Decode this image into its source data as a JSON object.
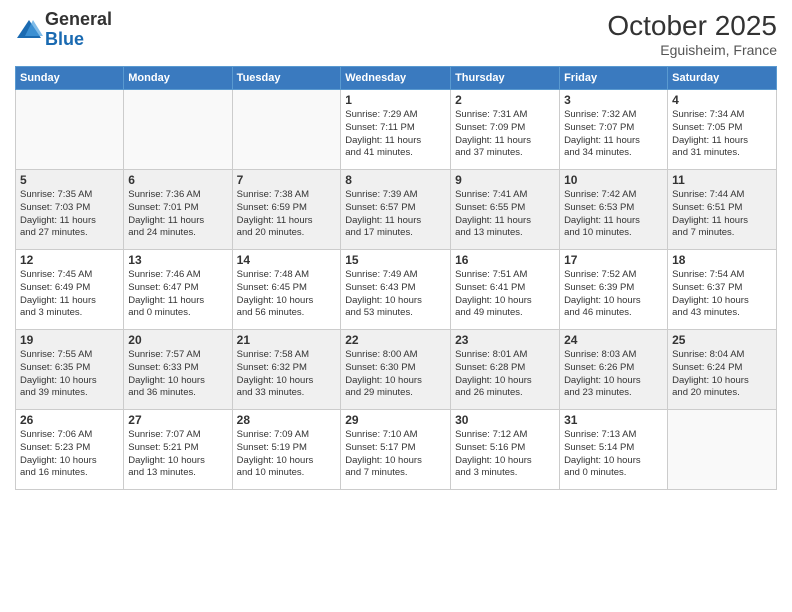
{
  "header": {
    "logo_general": "General",
    "logo_blue": "Blue",
    "month_title": "October 2025",
    "location": "Eguisheim, France"
  },
  "days_of_week": [
    "Sunday",
    "Monday",
    "Tuesday",
    "Wednesday",
    "Thursday",
    "Friday",
    "Saturday"
  ],
  "weeks": [
    [
      {
        "day": "",
        "info": ""
      },
      {
        "day": "",
        "info": ""
      },
      {
        "day": "",
        "info": ""
      },
      {
        "day": "1",
        "info": "Sunrise: 7:29 AM\nSunset: 7:11 PM\nDaylight: 11 hours\nand 41 minutes."
      },
      {
        "day": "2",
        "info": "Sunrise: 7:31 AM\nSunset: 7:09 PM\nDaylight: 11 hours\nand 37 minutes."
      },
      {
        "day": "3",
        "info": "Sunrise: 7:32 AM\nSunset: 7:07 PM\nDaylight: 11 hours\nand 34 minutes."
      },
      {
        "day": "4",
        "info": "Sunrise: 7:34 AM\nSunset: 7:05 PM\nDaylight: 11 hours\nand 31 minutes."
      }
    ],
    [
      {
        "day": "5",
        "info": "Sunrise: 7:35 AM\nSunset: 7:03 PM\nDaylight: 11 hours\nand 27 minutes."
      },
      {
        "day": "6",
        "info": "Sunrise: 7:36 AM\nSunset: 7:01 PM\nDaylight: 11 hours\nand 24 minutes."
      },
      {
        "day": "7",
        "info": "Sunrise: 7:38 AM\nSunset: 6:59 PM\nDaylight: 11 hours\nand 20 minutes."
      },
      {
        "day": "8",
        "info": "Sunrise: 7:39 AM\nSunset: 6:57 PM\nDaylight: 11 hours\nand 17 minutes."
      },
      {
        "day": "9",
        "info": "Sunrise: 7:41 AM\nSunset: 6:55 PM\nDaylight: 11 hours\nand 13 minutes."
      },
      {
        "day": "10",
        "info": "Sunrise: 7:42 AM\nSunset: 6:53 PM\nDaylight: 11 hours\nand 10 minutes."
      },
      {
        "day": "11",
        "info": "Sunrise: 7:44 AM\nSunset: 6:51 PM\nDaylight: 11 hours\nand 7 minutes."
      }
    ],
    [
      {
        "day": "12",
        "info": "Sunrise: 7:45 AM\nSunset: 6:49 PM\nDaylight: 11 hours\nand 3 minutes."
      },
      {
        "day": "13",
        "info": "Sunrise: 7:46 AM\nSunset: 6:47 PM\nDaylight: 11 hours\nand 0 minutes."
      },
      {
        "day": "14",
        "info": "Sunrise: 7:48 AM\nSunset: 6:45 PM\nDaylight: 10 hours\nand 56 minutes."
      },
      {
        "day": "15",
        "info": "Sunrise: 7:49 AM\nSunset: 6:43 PM\nDaylight: 10 hours\nand 53 minutes."
      },
      {
        "day": "16",
        "info": "Sunrise: 7:51 AM\nSunset: 6:41 PM\nDaylight: 10 hours\nand 49 minutes."
      },
      {
        "day": "17",
        "info": "Sunrise: 7:52 AM\nSunset: 6:39 PM\nDaylight: 10 hours\nand 46 minutes."
      },
      {
        "day": "18",
        "info": "Sunrise: 7:54 AM\nSunset: 6:37 PM\nDaylight: 10 hours\nand 43 minutes."
      }
    ],
    [
      {
        "day": "19",
        "info": "Sunrise: 7:55 AM\nSunset: 6:35 PM\nDaylight: 10 hours\nand 39 minutes."
      },
      {
        "day": "20",
        "info": "Sunrise: 7:57 AM\nSunset: 6:33 PM\nDaylight: 10 hours\nand 36 minutes."
      },
      {
        "day": "21",
        "info": "Sunrise: 7:58 AM\nSunset: 6:32 PM\nDaylight: 10 hours\nand 33 minutes."
      },
      {
        "day": "22",
        "info": "Sunrise: 8:00 AM\nSunset: 6:30 PM\nDaylight: 10 hours\nand 29 minutes."
      },
      {
        "day": "23",
        "info": "Sunrise: 8:01 AM\nSunset: 6:28 PM\nDaylight: 10 hours\nand 26 minutes."
      },
      {
        "day": "24",
        "info": "Sunrise: 8:03 AM\nSunset: 6:26 PM\nDaylight: 10 hours\nand 23 minutes."
      },
      {
        "day": "25",
        "info": "Sunrise: 8:04 AM\nSunset: 6:24 PM\nDaylight: 10 hours\nand 20 minutes."
      }
    ],
    [
      {
        "day": "26",
        "info": "Sunrise: 7:06 AM\nSunset: 5:23 PM\nDaylight: 10 hours\nand 16 minutes."
      },
      {
        "day": "27",
        "info": "Sunrise: 7:07 AM\nSunset: 5:21 PM\nDaylight: 10 hours\nand 13 minutes."
      },
      {
        "day": "28",
        "info": "Sunrise: 7:09 AM\nSunset: 5:19 PM\nDaylight: 10 hours\nand 10 minutes."
      },
      {
        "day": "29",
        "info": "Sunrise: 7:10 AM\nSunset: 5:17 PM\nDaylight: 10 hours\nand 7 minutes."
      },
      {
        "day": "30",
        "info": "Sunrise: 7:12 AM\nSunset: 5:16 PM\nDaylight: 10 hours\nand 3 minutes."
      },
      {
        "day": "31",
        "info": "Sunrise: 7:13 AM\nSunset: 5:14 PM\nDaylight: 10 hours\nand 0 minutes."
      },
      {
        "day": "",
        "info": ""
      }
    ]
  ]
}
